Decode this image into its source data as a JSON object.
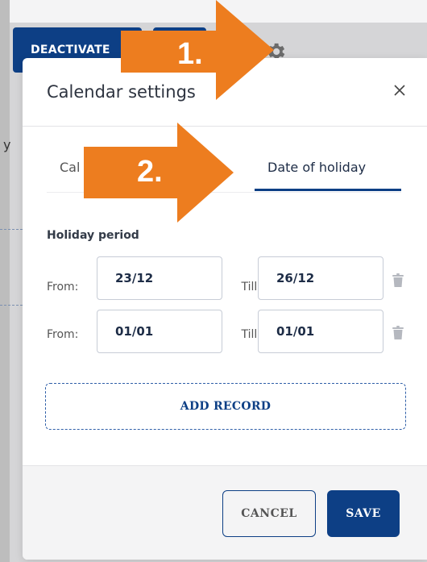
{
  "background": {
    "buttons": {
      "deactivate_label": "DEACTIVATE",
      "second_label": ""
    },
    "side_letter": "y"
  },
  "modal": {
    "title": "Calendar settings",
    "close_label": "×",
    "tabs": [
      {
        "label": "Cal"
      },
      {
        "label": "Date of holiday",
        "active": true
      }
    ],
    "section_label": "Holiday period",
    "rows": [
      {
        "from_label": "From:",
        "from_value": "23/12",
        "till_label": "Till:",
        "till_value": "26/12"
      },
      {
        "from_label": "From:",
        "from_value": "01/01",
        "till_label": "Till:",
        "till_value": "01/01"
      }
    ],
    "add_record_label": "ADD RECORD",
    "footer": {
      "cancel_label": "CANCEL",
      "save_label": "SAVE"
    }
  },
  "annotations": {
    "step1": "1.",
    "step2": "2.",
    "color": "#ED7D1F"
  },
  "colors": {
    "primary": "#0d3f85",
    "text_dark": "#2e3440"
  }
}
